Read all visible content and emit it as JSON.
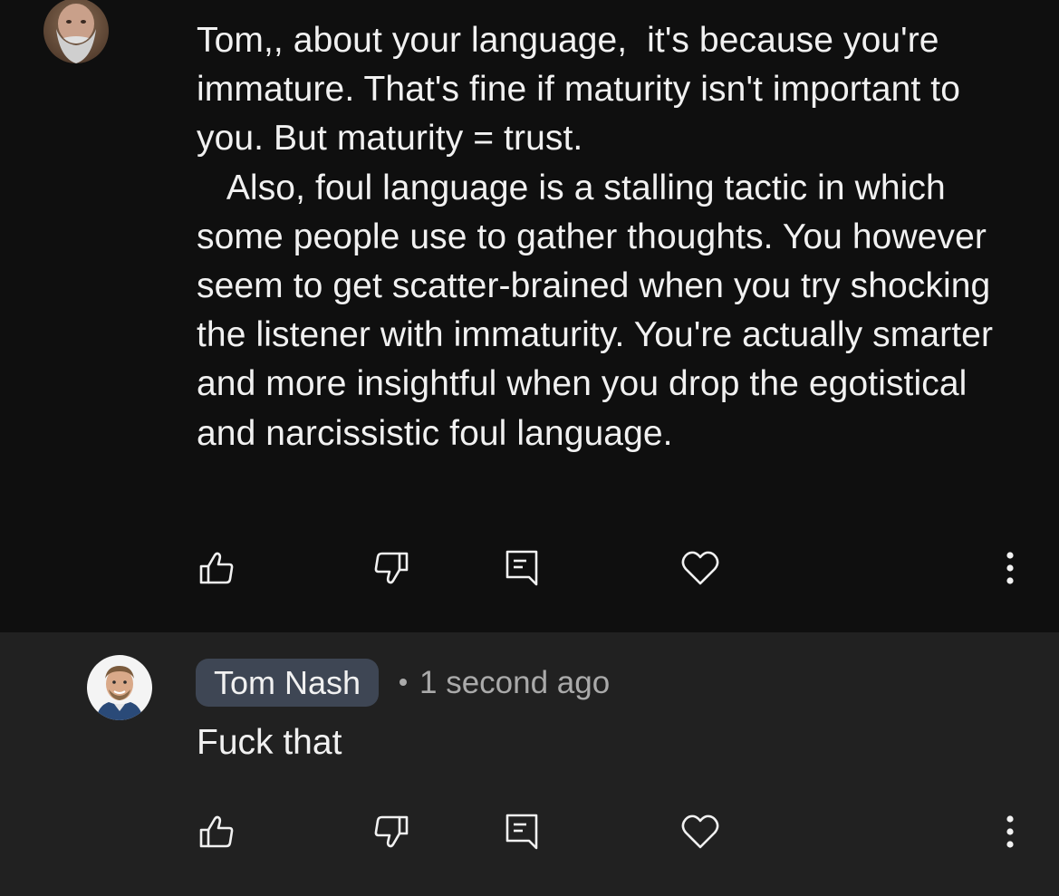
{
  "comments": [
    {
      "text": "Tom,, about your language,  it's because you're immature. That's fine if maturity isn't important to you. But maturity = trust.\n   Also, foul language is a stalling tactic in which some people use to gather thoughts. You however seem to get scatter-brained when you try shocking the listener with immaturity. You're actually smarter and more insightful when you drop the egotistical and narcissistic foul language.",
      "actions": {
        "like_icon": "thumbs-up-icon",
        "dislike_icon": "thumbs-down-icon",
        "reply_icon": "reply-comment-icon",
        "heart_icon": "heart-icon",
        "more_icon": "more-vertical-icon"
      }
    },
    {
      "author": "Tom Nash",
      "time": "1 second ago",
      "text": "Fuck that",
      "actions": {
        "like_icon": "thumbs-up-icon",
        "dislike_icon": "thumbs-down-icon",
        "reply_icon": "reply-comment-icon",
        "heart_icon": "heart-icon",
        "more_icon": "more-vertical-icon"
      }
    }
  ],
  "colors": {
    "background": "#0f0f0f",
    "reply_background": "#212121",
    "text": "#f1f1f1",
    "meta_text": "#aaaaaa",
    "author_chip": "#3e4654"
  }
}
